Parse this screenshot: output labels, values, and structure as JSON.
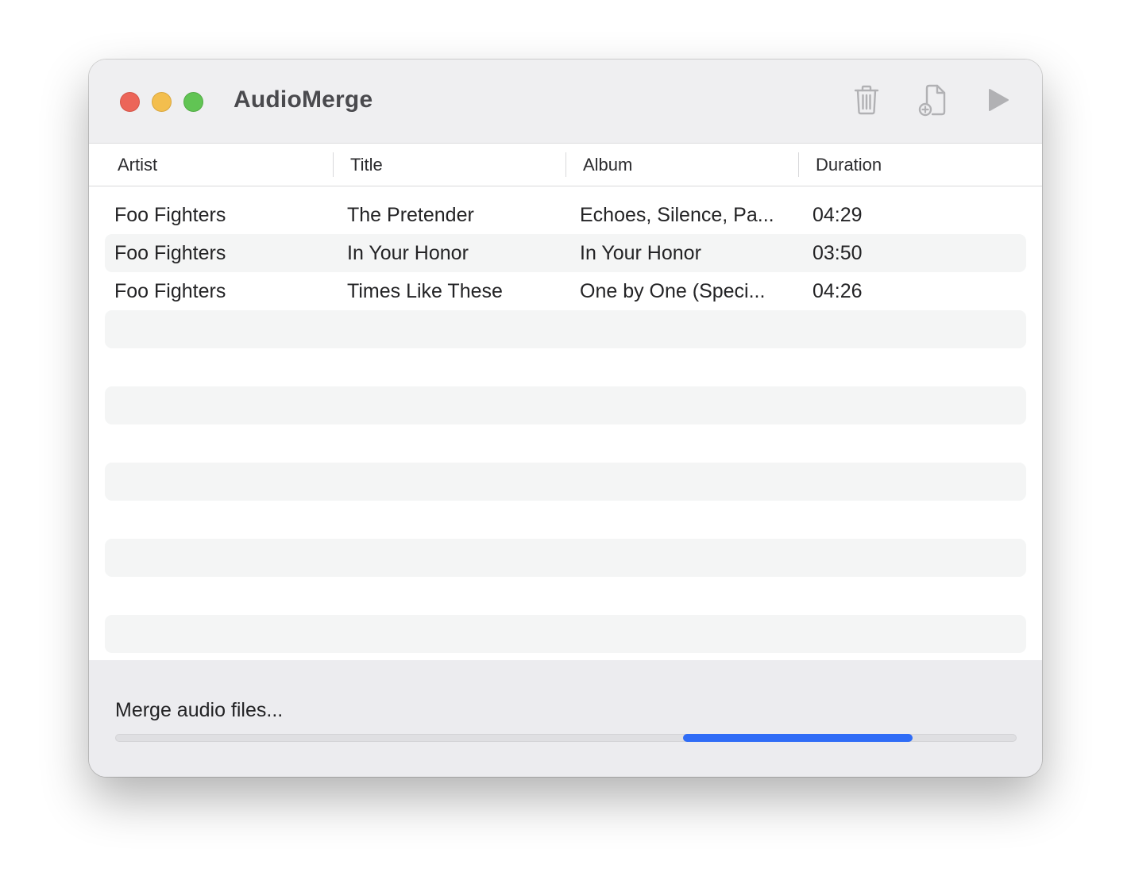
{
  "window": {
    "title": "AudioMerge"
  },
  "toolbar": {
    "icons": [
      "trash-icon",
      "add-file-icon",
      "play-icon"
    ]
  },
  "table": {
    "columns": [
      "Artist",
      "Title",
      "Album",
      "Duration"
    ],
    "rows": [
      {
        "artist": "Foo Fighters",
        "title": "The Pretender",
        "album": "Echoes, Silence, Pa...",
        "duration": "04:29"
      },
      {
        "artist": "Foo Fighters",
        "title": "In Your Honor",
        "album": "In Your Honor",
        "duration": "03:50"
      },
      {
        "artist": "Foo Fighters",
        "title": "Times Like These",
        "album": "One by One (Speci...",
        "duration": "04:26"
      }
    ]
  },
  "status": {
    "text": "Merge audio files...",
    "progress_indicator": "indeterminate",
    "accent_color": "#2f6cf6"
  },
  "colors": {
    "close": "#ec6559",
    "minimize": "#f3be4e",
    "maximize": "#61c454"
  }
}
